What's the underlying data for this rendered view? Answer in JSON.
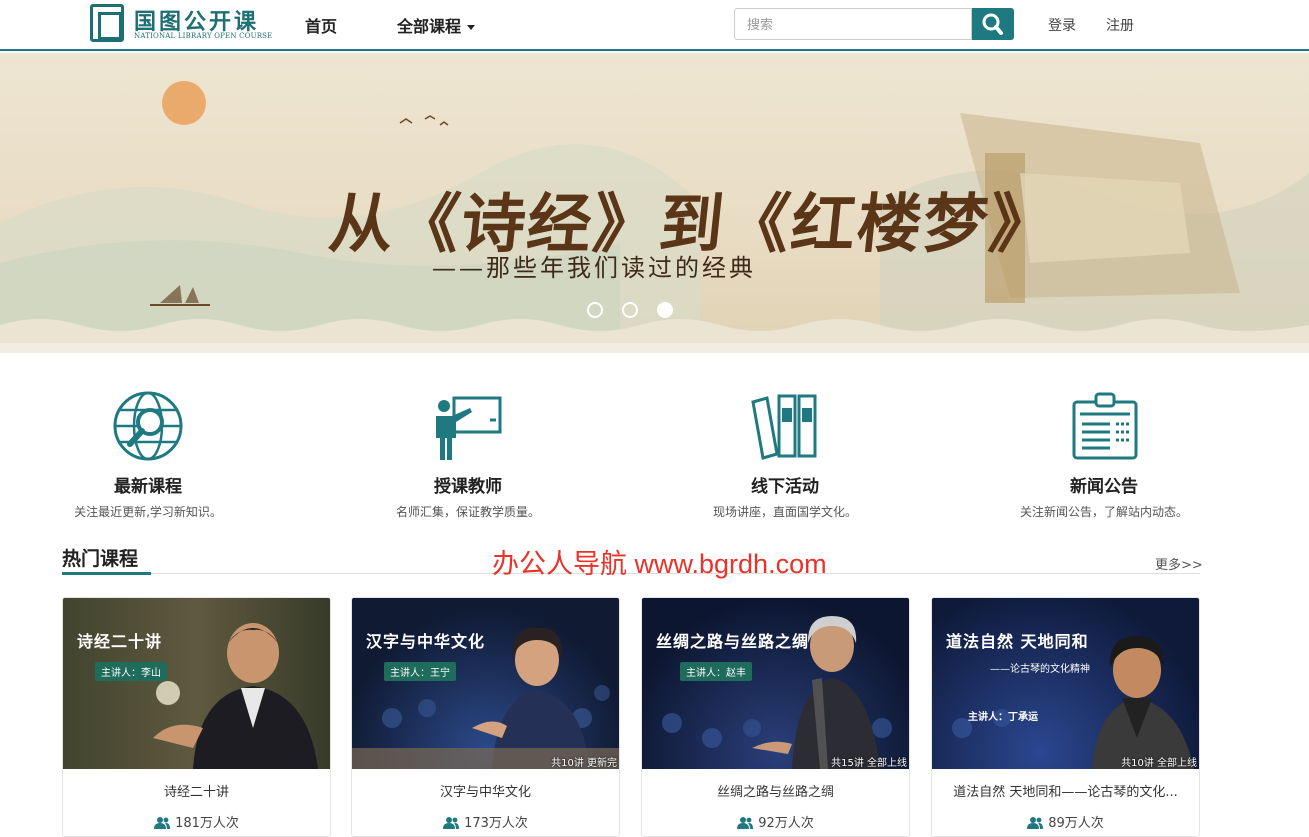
{
  "header": {
    "logo_cn": "国图公开课",
    "logo_en": "NATIONAL LIBRARY OPEN COURSE",
    "nav_home": "首页",
    "nav_all_courses": "全部课程",
    "search_placeholder": "搜索",
    "login": "登录",
    "register": "注册"
  },
  "banner": {
    "title": "从《诗经》到《红楼梦》",
    "subtitle": "——那些年我们读过的经典",
    "slide_count": 3,
    "active_slide": 3
  },
  "features": [
    {
      "icon": "globe-search-icon",
      "title": "最新课程",
      "desc": "关注最近更新,学习新知识。"
    },
    {
      "icon": "teacher-board-icon",
      "title": "授课教师",
      "desc": "名师汇集，保证教学质量。"
    },
    {
      "icon": "books-icon",
      "title": "线下活动",
      "desc": "现场讲座，直面国学文化。"
    },
    {
      "icon": "clipboard-icon",
      "title": "新闻公告",
      "desc": "关注新闻公告，了解站内动态。"
    }
  ],
  "hot_courses": {
    "title": "热门课程",
    "more": "更多>>",
    "watermark": "办公人导航 www.bgrdh.com",
    "courses": [
      {
        "thumb_title": "诗经二十讲",
        "lecturer_tag": "主讲人：李山",
        "badge": "",
        "name": "诗经二十讲",
        "views": "181万人次",
        "bg": "#5c4a36"
      },
      {
        "thumb_title": "汉字与中华文化",
        "lecturer_tag": "主讲人：王宁",
        "badge": "共10讲  更新完",
        "name": "汉字与中华文化",
        "views": "173万人次",
        "bg": "#1a2a4a"
      },
      {
        "thumb_title": "丝绸之路与丝路之绸",
        "lecturer_tag": "主讲人：赵丰",
        "badge": "共15讲  全部上线",
        "name": "丝绸之路与丝路之绸",
        "views": "92万人次",
        "bg": "#16244a"
      },
      {
        "thumb_title": "道法自然  天地同和",
        "thumb_sub": "——论古琴的文化精神",
        "lecturer_tag": "主讲人：丁承运",
        "badge": "共10讲  全部上线",
        "name": "道法自然 天地同和——论古琴的文化...",
        "views": "89万人次",
        "bg": "#1a2c5c"
      }
    ]
  },
  "colors": {
    "brand": "#1e7a80",
    "watermark": "#e8322a"
  }
}
